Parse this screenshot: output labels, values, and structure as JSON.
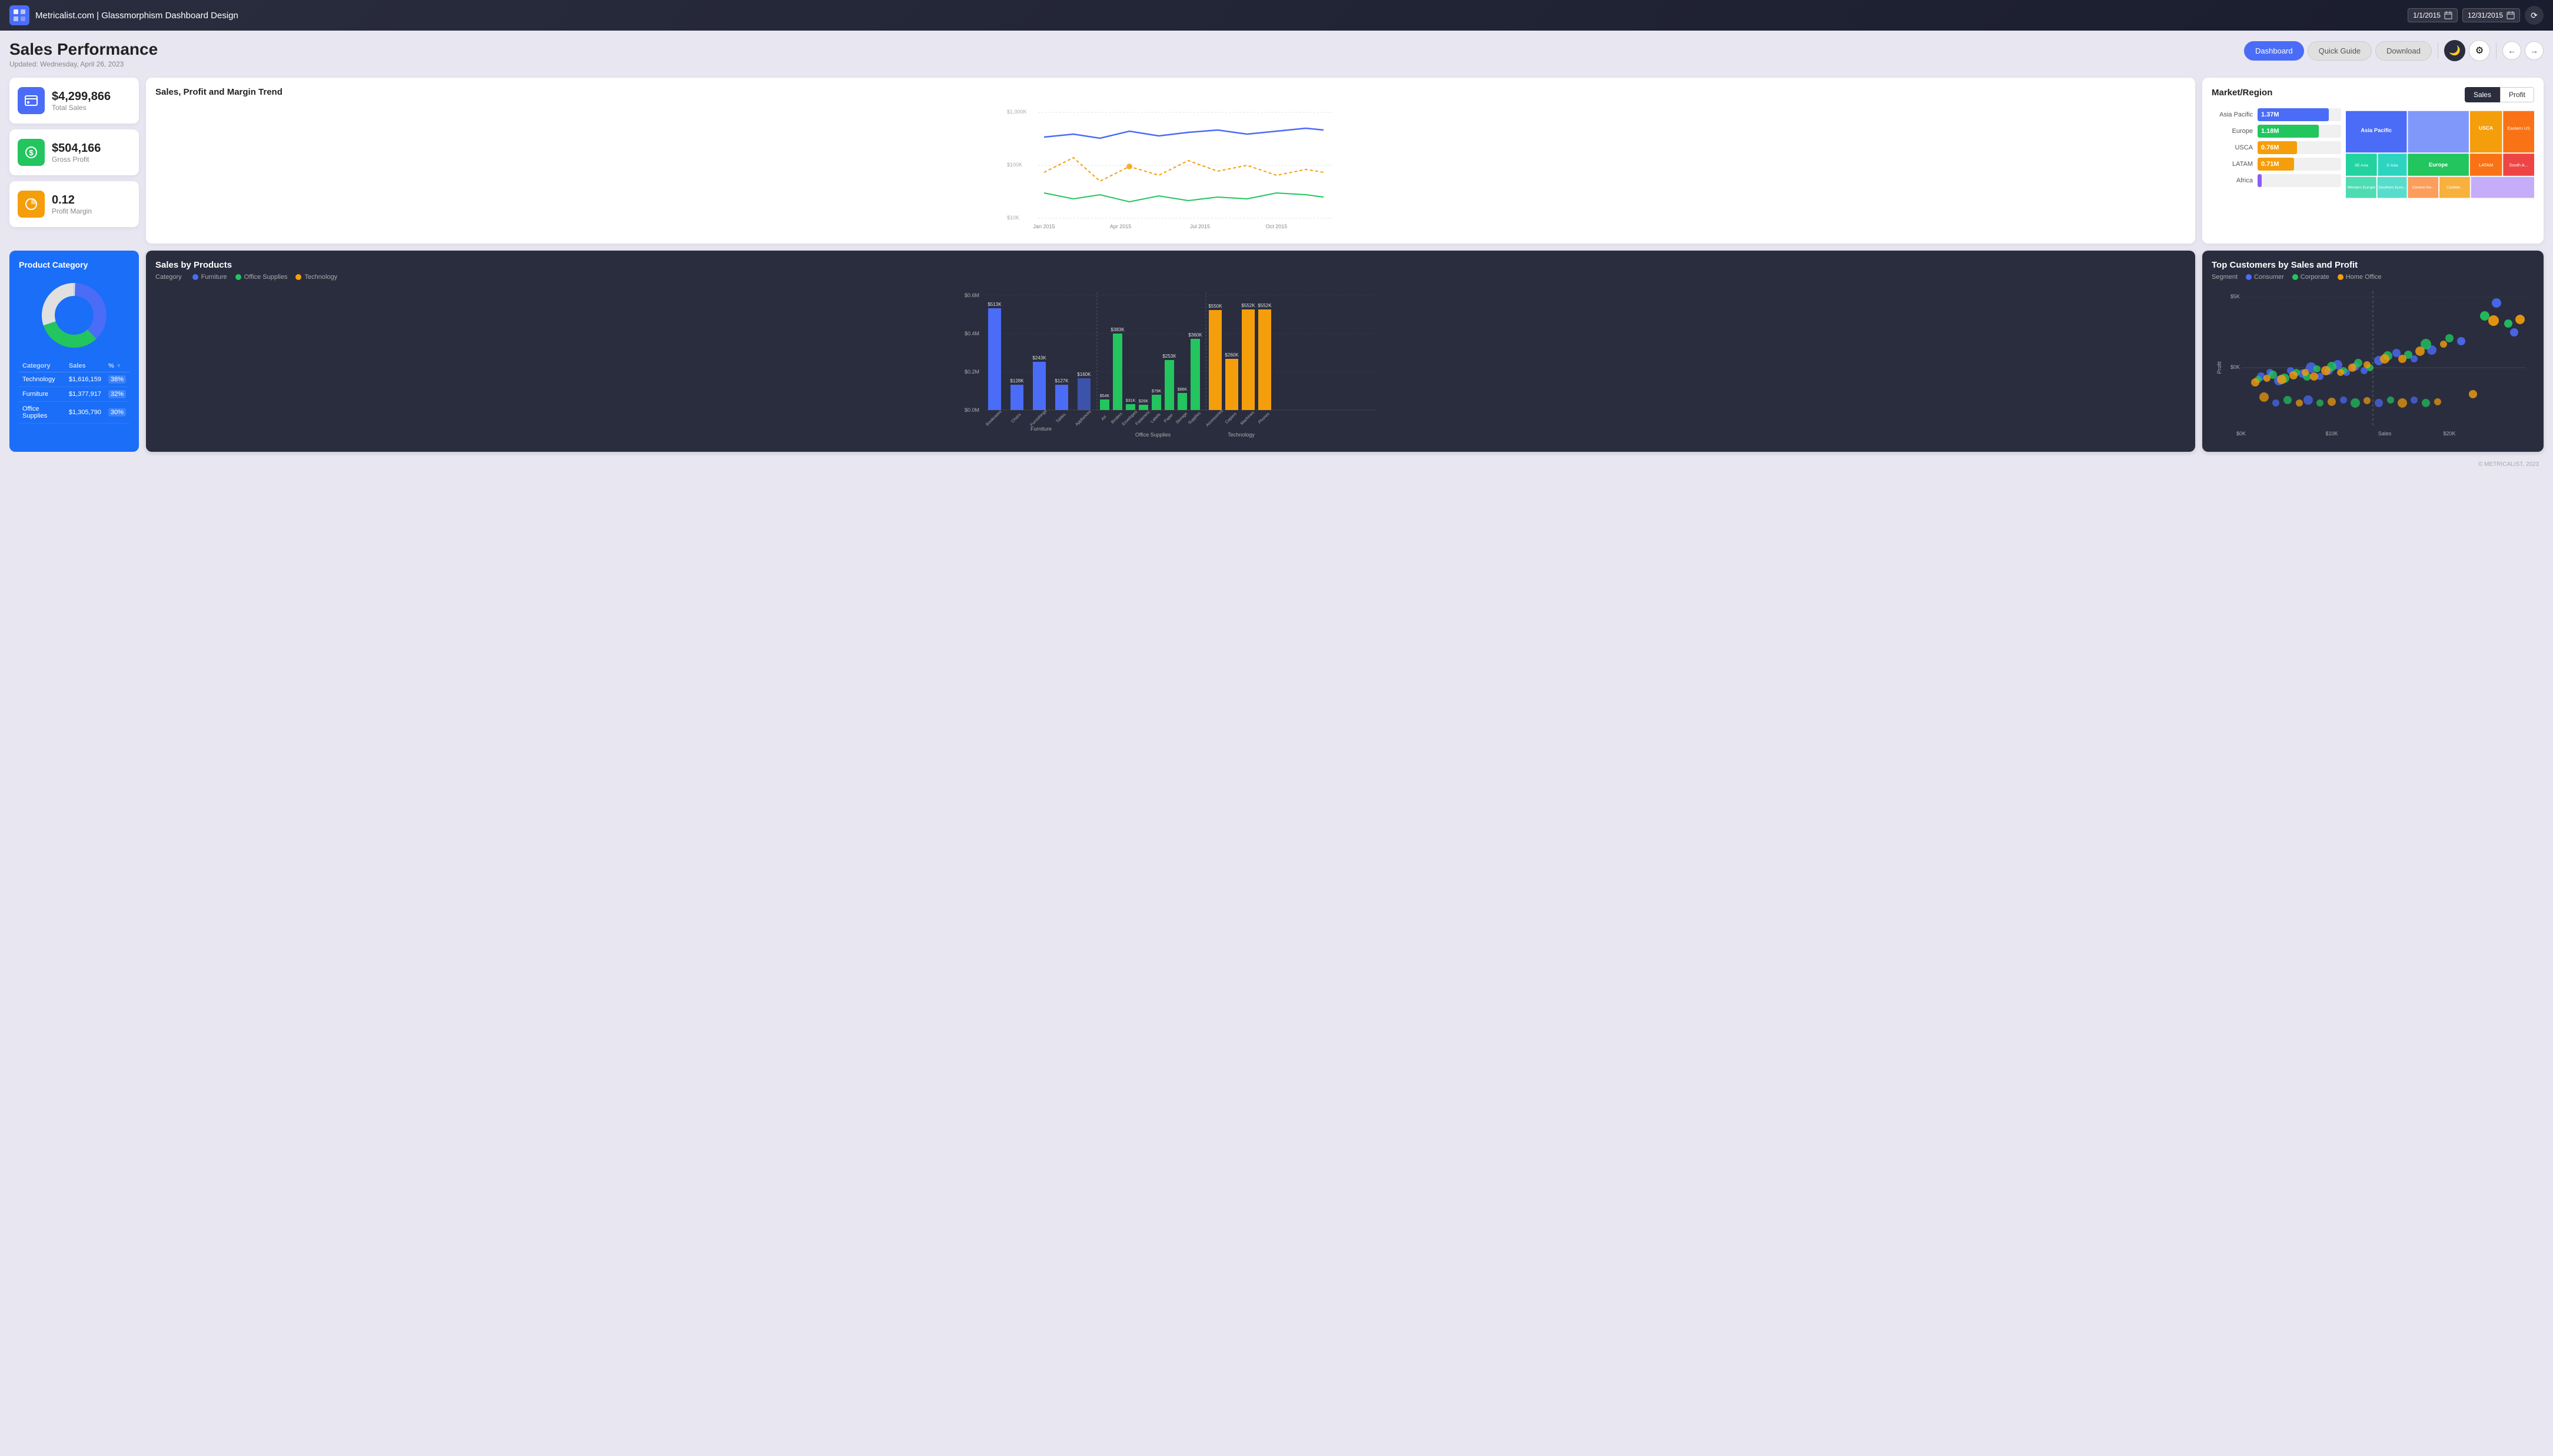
{
  "header": {
    "logo": "≡",
    "title": "Metricalist.com | Glassmorphism Dashboard Design",
    "date_start": "1/1/2015",
    "date_end": "12/31/2015",
    "calendar_icon": "📅"
  },
  "page": {
    "title": "Sales Performance",
    "subtitle": "Updated: Wednesday, April 26, 2023"
  },
  "nav": {
    "dashboard_label": "Dashboard",
    "quick_guide_label": "Quick Guide",
    "download_label": "Download"
  },
  "kpis": [
    {
      "label": "Total Sales",
      "value": "$4,299,866",
      "color": "blue",
      "icon": "▤"
    },
    {
      "label": "Gross Profit",
      "value": "$504,166",
      "color": "green",
      "icon": "$"
    },
    {
      "label": "Profit Margin",
      "value": "0.12",
      "color": "orange",
      "icon": "◔"
    }
  ],
  "trend_chart": {
    "title": "Sales, Profit and Margin Trend",
    "y_labels": [
      "$1,000K",
      "$100K",
      "$10K"
    ],
    "x_labels": [
      "Jan 2015",
      "Apr 2015",
      "Jul 2015",
      "Oct 2015"
    ]
  },
  "market_region": {
    "title": "Market/Region",
    "toggle_sales": "Sales",
    "toggle_profit": "Profit",
    "bars": [
      {
        "label": "Asia Pacific",
        "value": "1.37M",
        "pct": 85,
        "color": "#4a6cf7"
      },
      {
        "label": "Europe",
        "value": "1.18M",
        "pct": 73,
        "color": "#22c55e"
      },
      {
        "label": "USCA",
        "value": "0.76M",
        "pct": 47,
        "color": "#f59e0b"
      },
      {
        "label": "LATAM",
        "value": "0.71M",
        "pct": 44,
        "color": "#f59e0b"
      },
      {
        "label": "Africa",
        "value": "",
        "pct": 5,
        "color": "#8b5cf6"
      }
    ],
    "treemap": [
      {
        "label": "Asia Pacific",
        "color": "#4a6cf7",
        "size": 22
      },
      {
        "label": "USCA",
        "color": "#f59e0b",
        "size": 14
      },
      {
        "label": "Southeastern Asia",
        "color": "#22c55e",
        "size": 11
      },
      {
        "label": "Eastern Asia",
        "color": "#2dd4bf",
        "size": 10
      },
      {
        "label": "Eastern US",
        "color": "#f97316",
        "size": 12
      },
      {
        "label": "Europe",
        "color": "#22c55e",
        "size": 18
      },
      {
        "label": "LATAM",
        "color": "#f97316",
        "size": 10
      },
      {
        "label": "Western Europe",
        "color": "#22d3a0",
        "size": 9
      },
      {
        "label": "Southern Euro...",
        "color": "#2dd4bf",
        "size": 8
      },
      {
        "label": "Central Am...",
        "color": "#f97316",
        "size": 6
      },
      {
        "label": "South A...",
        "color": "#ef4444",
        "size": 5
      },
      {
        "label": "Caribbe...",
        "color": "#f59e0b",
        "size": 4
      }
    ]
  },
  "product_category": {
    "title": "Product Category",
    "categories": [
      {
        "name": "Technology",
        "sales": "$1,616,159",
        "pct": "38%"
      },
      {
        "name": "Furniture",
        "sales": "$1,377,917",
        "pct": "32%"
      },
      {
        "name": "Office Supplies",
        "sales": "$1,305,790",
        "pct": "30%"
      }
    ],
    "donut_colors": [
      "#4a6cf7",
      "#22c55e",
      "#e0e0e0"
    ],
    "col_category": "Category",
    "col_sales": "Sales",
    "col_pct": "%"
  },
  "sales_by_products": {
    "title": "Sales by Products",
    "legend": [
      {
        "label": "Furniture",
        "color": "#4a6cf7"
      },
      {
        "label": "Office Supplies",
        "color": "#22c55e"
      },
      {
        "label": "Technology",
        "color": "#f59e0b"
      }
    ],
    "categories": {
      "furniture": {
        "label": "Furniture",
        "items": [
          {
            "name": "Bookcases",
            "values": [
              513,
              0,
              0
            ]
          },
          {
            "name": "Chairs",
            "values": [
              0,
              128,
              0
            ]
          },
          {
            "name": "Furnishings",
            "values": [
              0,
              243,
              0
            ]
          },
          {
            "name": "Tables",
            "values": [
              0,
              127,
              0
            ]
          },
          {
            "name": "Appliances",
            "values": [
              0,
              160,
              0
            ]
          }
        ]
      }
    },
    "bars": [
      {
        "name": "Bookcases",
        "furniture": 513,
        "office": 0,
        "tech": 0
      },
      {
        "name": "Chairs",
        "furniture": 128,
        "office": 0,
        "tech": 0
      },
      {
        "name": "Furnishings",
        "furniture": 243,
        "office": 0,
        "tech": 0
      },
      {
        "name": "Tables",
        "furniture": 127,
        "office": 0,
        "tech": 0
      },
      {
        "name": "Appliances",
        "furniture": 0,
        "office": 0,
        "tech": 160
      },
      {
        "name": "Art",
        "furniture": 0,
        "office": 54,
        "tech": 0
      },
      {
        "name": "Binders",
        "furniture": 0,
        "office": 383,
        "tech": 0
      },
      {
        "name": "Envelopes",
        "furniture": 0,
        "office": 31,
        "tech": 0
      },
      {
        "name": "Fasteners",
        "furniture": 0,
        "office": 26,
        "tech": 0
      },
      {
        "name": "Labels",
        "furniture": 0,
        "office": 79,
        "tech": 0
      },
      {
        "name": "Paper",
        "furniture": 0,
        "office": 253,
        "tech": 0
      },
      {
        "name": "Storage",
        "furniture": 0,
        "office": 86,
        "tech": 0
      },
      {
        "name": "Supplies",
        "furniture": 0,
        "office": 360,
        "tech": 0
      },
      {
        "name": "Accessories",
        "furniture": 0,
        "office": 0,
        "tech": 550
      },
      {
        "name": "Copiers",
        "furniture": 0,
        "office": 0,
        "tech": 260
      },
      {
        "name": "Machines",
        "furniture": 0,
        "office": 0,
        "tech": 552
      },
      {
        "name": "Phones",
        "furniture": 0,
        "office": 0,
        "tech": 552
      }
    ],
    "group_labels": [
      "Furniture",
      "Office Supplies",
      "Technology"
    ]
  },
  "top_customers": {
    "title": "Top Customers by Sales and Profit",
    "x_label": "Sales",
    "y_label": "Profit",
    "legend": [
      {
        "label": "Consumer",
        "color": "#4a6cf7"
      },
      {
        "label": "Corporate",
        "color": "#22c55e"
      },
      {
        "label": "Home Office",
        "color": "#f59e0b"
      }
    ],
    "x_ticks": [
      "$0K",
      "$10K",
      "$20K"
    ],
    "y_ticks": [
      "$0K",
      "$5K"
    ]
  },
  "footer": {
    "text": "© METRICALIST, 2023"
  },
  "colors": {
    "accent_blue": "#4a6cf7",
    "accent_green": "#22c55e",
    "accent_orange": "#f59e0b",
    "dark_bg": "#2a2d3e",
    "light_bg": "#e8e6f0"
  }
}
